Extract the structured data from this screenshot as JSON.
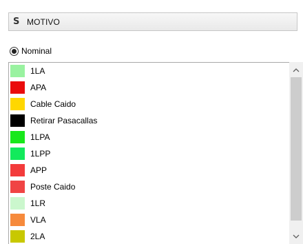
{
  "field": {
    "type_symbol": "S",
    "name": "MOTIVO"
  },
  "radio": {
    "label": "Nominal",
    "checked": true
  },
  "items": [
    {
      "label": "1LA",
      "color": "#99f2a0"
    },
    {
      "label": "APA",
      "color": "#ea0c0c"
    },
    {
      "label": "Cable Caido",
      "color": "#ffd700"
    },
    {
      "label": "Retirar Pasacallas",
      "color": "#000000"
    },
    {
      "label": "1LPA",
      "color": "#18e81b"
    },
    {
      "label": "1LPP",
      "color": "#12ea5c"
    },
    {
      "label": "APP",
      "color": "#f33b3b"
    },
    {
      "label": "Poste Caido",
      "color": "#f04444"
    },
    {
      "label": "1LR",
      "color": "#cbf7cd"
    },
    {
      "label": "VLA",
      "color": "#f68a3c"
    },
    {
      "label": "2LA",
      "color": "#c8c800"
    }
  ],
  "scrollbar": {
    "up_icon": "chevron-up-icon",
    "down_icon": "chevron-down-icon"
  }
}
